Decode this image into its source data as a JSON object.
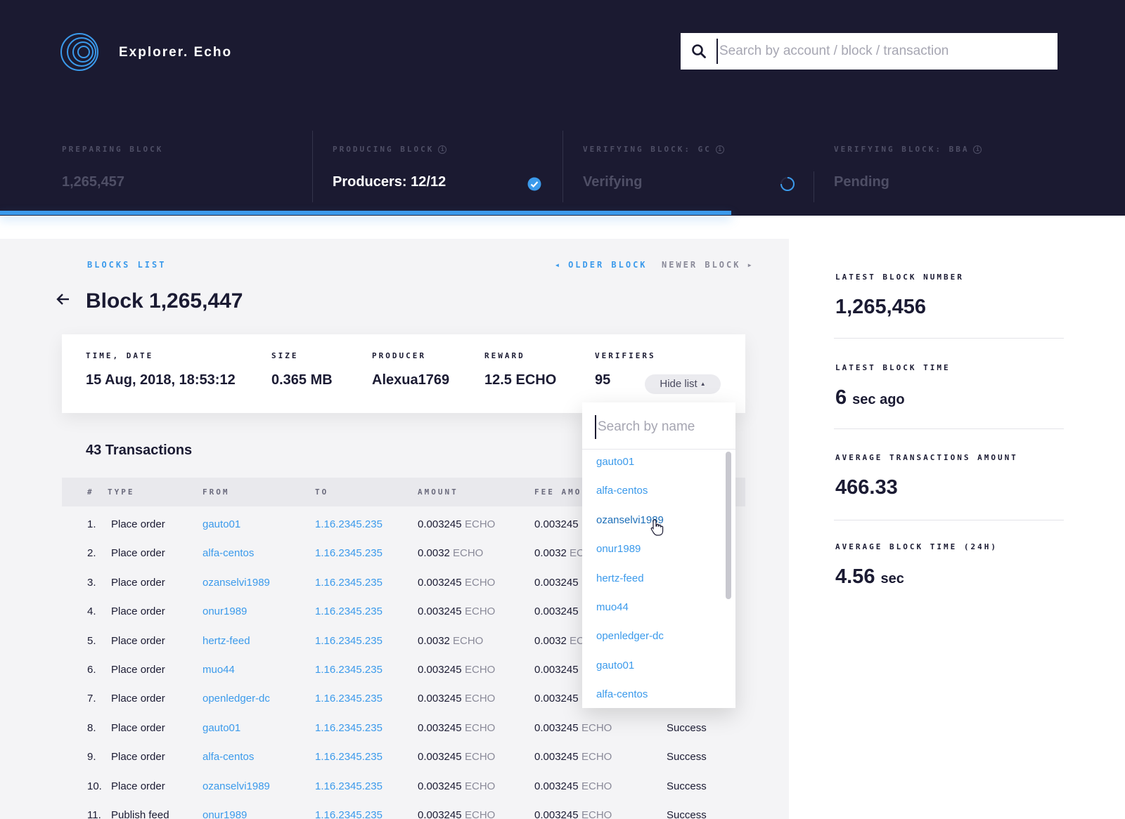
{
  "header": {
    "brand": "Explorer. Echo",
    "search_placeholder": "Search by account / block / transaction"
  },
  "stages": [
    {
      "label": "PREPARING BLOCK",
      "value": "1,265,457",
      "value_color": "#4f4f66"
    },
    {
      "label": "PRODUCING BLOCK",
      "value": "Producers: 12/12",
      "value_color": "#ffffff"
    },
    {
      "label": "VERIFYING BLOCK: GC",
      "value": "Verifying",
      "value_color": "#4f4f66"
    },
    {
      "label": "VERIFYING BLOCK: BBA",
      "value": "Pending",
      "value_color": "#4f4f66"
    }
  ],
  "progress_fraction": 0.65,
  "nav": {
    "blocks_list": "BLOCKS LIST",
    "older": "OLDER BLOCK",
    "newer": "NEWER BLOCK"
  },
  "block": {
    "title": "Block 1,265,447",
    "time_label": "TIME, DATE",
    "time_value": "15 Aug, 2018, 18:53:12",
    "size_label": "SIZE",
    "size_value": "0.365 MB",
    "producer_label": "PRODUCER",
    "producer_value": "Alexua1769",
    "reward_label": "REWARD",
    "reward_value": "12.5 ECHO",
    "verifiers_label": "VERIFIERS",
    "verifiers_value": "95",
    "hide_list": "Hide list"
  },
  "transactions": {
    "count_label": "43 Transactions",
    "columns": [
      "#",
      "TYPE",
      "FROM",
      "TO",
      "AMOUNT",
      "FEE AMO"
    ],
    "unit": "ECHO",
    "rows": [
      {
        "num": "1.",
        "type": "Place order",
        "from": "gauto01",
        "to": "1.16.2345.235",
        "amount": "0.003245",
        "fee": "0.003245",
        "status": ""
      },
      {
        "num": "2.",
        "type": "Place order",
        "from": "alfa-centos",
        "to": "1.16.2345.235",
        "amount": "0.0032",
        "fee": "0.0032",
        "status": ""
      },
      {
        "num": "3.",
        "type": "Place order",
        "from": "ozanselvi1989",
        "to": "1.16.2345.235",
        "amount": "0.003245",
        "fee": "0.003245",
        "status": ""
      },
      {
        "num": "4.",
        "type": "Place order",
        "from": "onur1989",
        "to": "1.16.2345.235",
        "amount": "0.003245",
        "fee": "0.003245",
        "status": ""
      },
      {
        "num": "5.",
        "type": "Place order",
        "from": "hertz-feed",
        "to": "1.16.2345.235",
        "amount": "0.0032",
        "fee": "0.0032",
        "status": ""
      },
      {
        "num": "6.",
        "type": "Place order",
        "from": "muo44",
        "to": "1.16.2345.235",
        "amount": "0.003245",
        "fee": "0.003245",
        "status": ""
      },
      {
        "num": "7.",
        "type": "Place order",
        "from": "openledger-dc",
        "to": "1.16.2345.235",
        "amount": "0.003245",
        "fee": "0.003245",
        "status": ""
      },
      {
        "num": "8.",
        "type": "Place order",
        "from": "gauto01",
        "to": "1.16.2345.235",
        "amount": "0.003245",
        "fee": "0.003245",
        "status": "Success"
      },
      {
        "num": "9.",
        "type": "Place order",
        "from": "alfa-centos",
        "to": "1.16.2345.235",
        "amount": "0.003245",
        "fee": "0.003245",
        "status": "Success"
      },
      {
        "num": "10.",
        "type": "Place order",
        "from": "ozanselvi1989",
        "to": "1.16.2345.235",
        "amount": "0.003245",
        "fee": "0.003245",
        "status": "Success"
      },
      {
        "num": "11.",
        "type": "Publish feed",
        "from": "onur1989",
        "to": "1.16.2345.235",
        "amount": "0.003245",
        "fee": "0.003245",
        "status": "Success"
      }
    ]
  },
  "verifiers_dropdown": {
    "placeholder": "Search by name",
    "items": [
      "gauto01",
      "alfa-centos",
      "ozanselvi1989",
      "onur1989",
      "hertz-feed",
      "muo44",
      "openledger-dc",
      "gauto01",
      "alfa-centos"
    ]
  },
  "sidebar": {
    "latest_block_label": "LATEST BLOCK NUMBER",
    "latest_block_value": "1,265,456",
    "latest_time_label": "LATEST BLOCK TIME",
    "latest_time_value": "6",
    "latest_time_unit": "sec ago",
    "avg_tx_label": "AVERAGE TRANSACTIONS AMOUNT",
    "avg_tx_value": "466.33",
    "avg_block_label": "AVERAGE BLOCK TIME (24H)",
    "avg_block_value": "4.56",
    "avg_block_unit": "sec"
  },
  "colors": {
    "header_bg": "#1b1a31",
    "accent": "#3b9aeb",
    "panel_bg": "#f4f4f6"
  }
}
